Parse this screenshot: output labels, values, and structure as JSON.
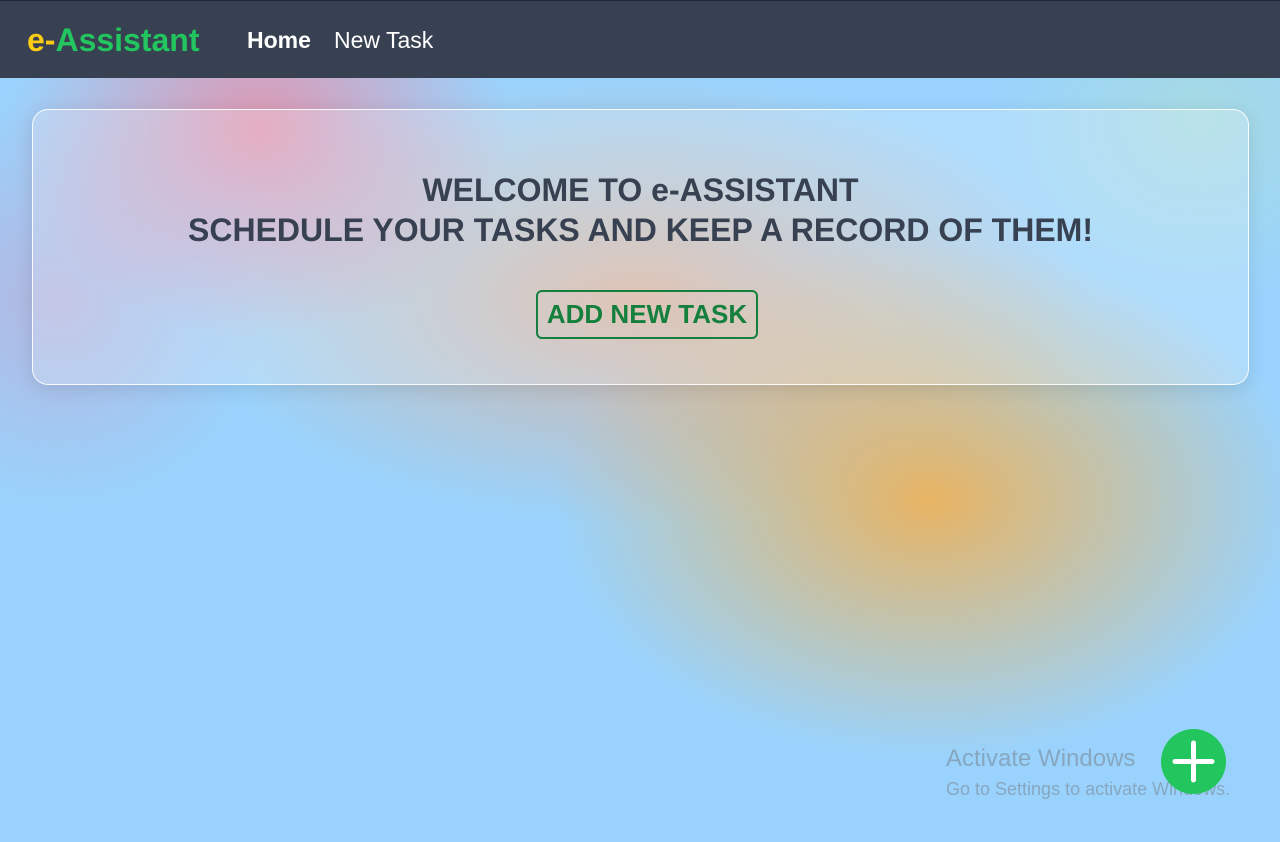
{
  "nav": {
    "logo_prefix": "e-",
    "logo_suffix": "Assistant",
    "links": [
      {
        "label": "Home",
        "active": true
      },
      {
        "label": "New Task",
        "active": false
      }
    ]
  },
  "hero": {
    "title_line1": "WELCOME TO e-ASSISTANT",
    "title_line2": "SCHEDULE YOUR TASKS AND KEEP A RECORD OF THEM!",
    "button_label": "ADD NEW TASK"
  },
  "watermark": {
    "title": "Activate Windows",
    "subtitle": "Go to Settings to activate Windows."
  },
  "fab": {
    "icon": "plus-icon"
  },
  "colors": {
    "navbar_bg": "#374151",
    "logo_prefix": "#facc15",
    "logo_suffix": "#22c55e",
    "heading_text": "#374151",
    "button_green": "#15803d",
    "fab_bg": "#22c55e",
    "page_bg": "#99d3fd"
  }
}
